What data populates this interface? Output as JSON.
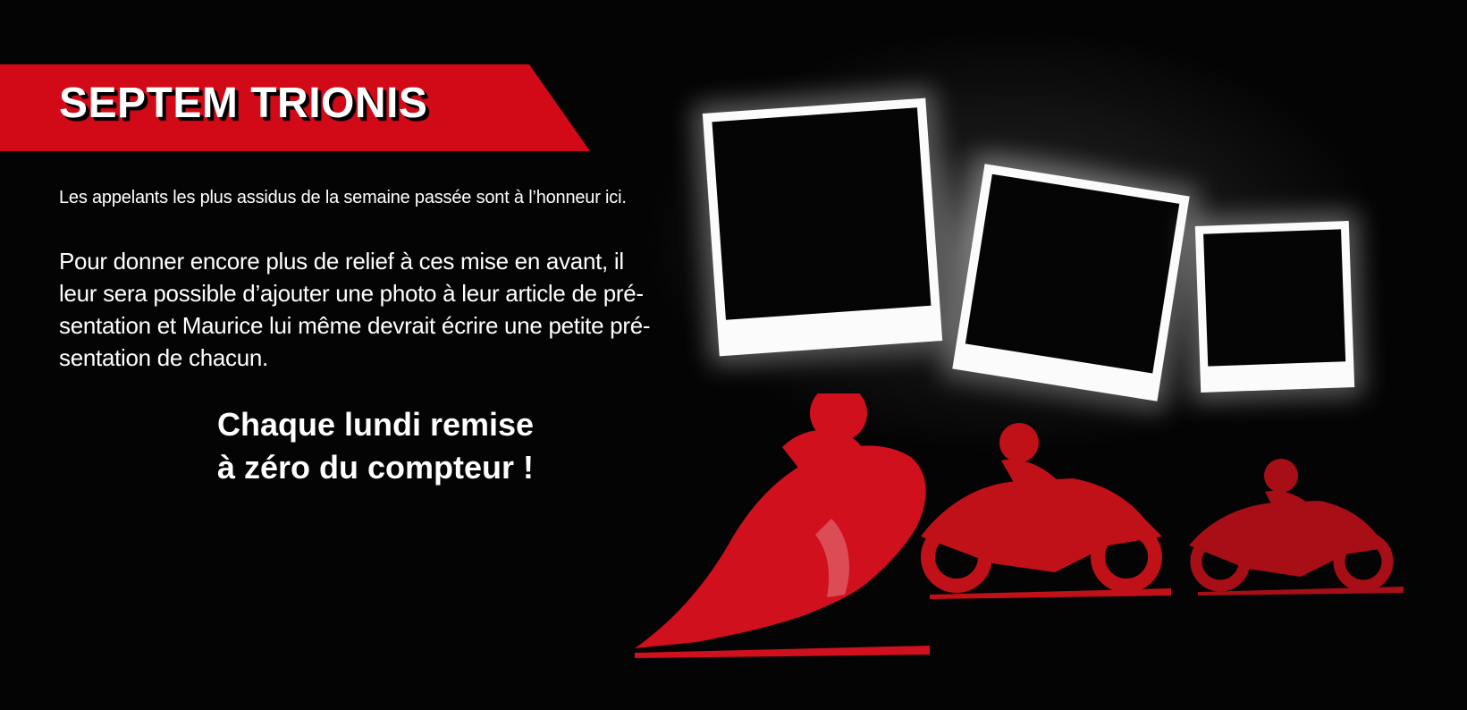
{
  "banner": {
    "title": "SEPTEM TRIONIS",
    "color": "#d20a17"
  },
  "content": {
    "intro": "Les appelants les plus assidus de la semaine passée sont à l’honneur ici.",
    "body_lines": [
      "Pour donner encore plus de relief à ces mise en avant, il",
      "leur sera possible d’ajouter une photo à leur article de pré-",
      "sentation et Maurice lui même devrait écrire une petite pré-",
      "sentation de chacun."
    ],
    "callout_lines": [
      "Chaque lundi remise",
      "à zéro du compteur !"
    ]
  },
  "illustration": {
    "photo_frames": [
      "empty-photo-frame",
      "empty-photo-frame",
      "empty-photo-frame"
    ],
    "motorcycle_riders": [
      "motorcycle-rider-icon",
      "motorcycle-rider-icon",
      "motorcycle-rider-icon"
    ],
    "rider_colors": [
      "#d0101c",
      "#c01018",
      "#a80e16"
    ]
  }
}
